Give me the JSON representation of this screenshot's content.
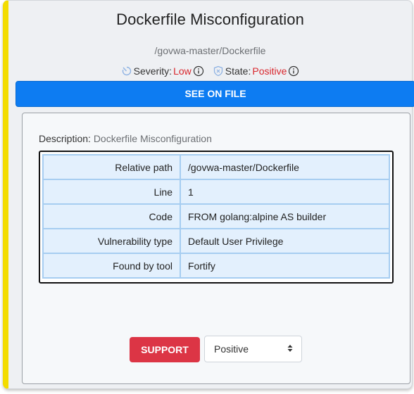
{
  "header": {
    "title": "Dockerfile Misconfiguration",
    "file_path": "/govwa-master/Dockerfile",
    "severity_label": "Severity:",
    "severity_value": "Low",
    "state_label": "State:",
    "state_value": "Positive"
  },
  "actions": {
    "see_on_file": "SEE ON FILE",
    "support": "SUPPORT",
    "state_select_value": "Positive"
  },
  "details": {
    "description_label": "Description:",
    "description_value": "Dockerfile Misconfiguration",
    "rows": [
      {
        "key": "Relative path",
        "value": "/govwa-master/Dockerfile"
      },
      {
        "key": "Line",
        "value": "1"
      },
      {
        "key": "Code",
        "value": "FROM golang:alpine AS builder"
      },
      {
        "key": "Vulnerability type",
        "value": "Default User Privilege"
      },
      {
        "key": "Found by tool",
        "value": "Fortify"
      }
    ]
  },
  "colors": {
    "accent_bar": "#f3dc00",
    "primary_button": "#0d7cf2",
    "danger_button": "#dc3545",
    "severity_text": "#d9262c"
  },
  "icons": {
    "severity": "gauge-icon",
    "severity_info": "info-icon",
    "state": "shield-icon",
    "state_info": "info-icon",
    "select_caret": "sort-caret-icon"
  }
}
